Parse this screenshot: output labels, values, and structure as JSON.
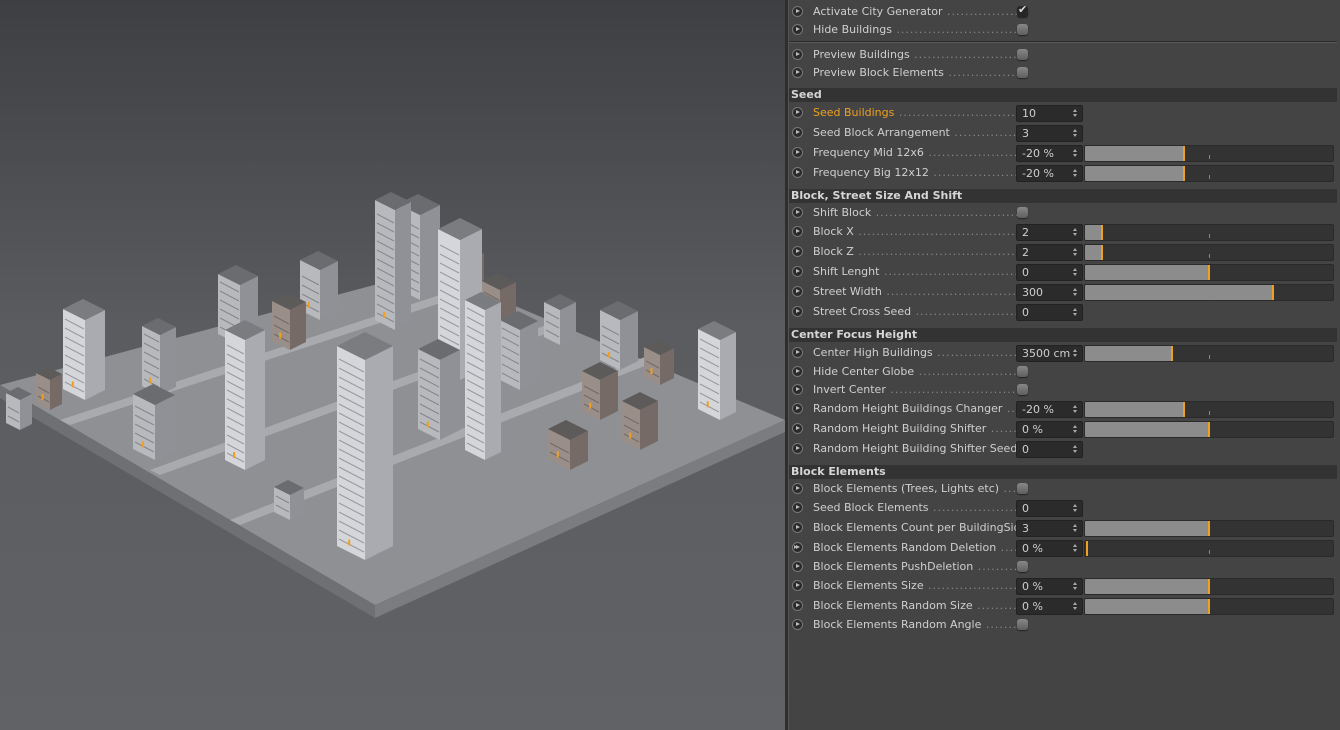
{
  "viewport": {
    "description": "3D render of procedural city block",
    "accent": "#f0a020"
  },
  "panel": {
    "top_rows": [
      {
        "label": "Activate City Generator",
        "type": "checkbox",
        "checked": true
      },
      {
        "label": "Hide Buildings",
        "type": "checkbox",
        "checked": false
      },
      {
        "label": "Preview Buildings",
        "type": "checkbox",
        "checked": false
      },
      {
        "label": "Preview Block Elements",
        "type": "checkbox",
        "checked": false
      }
    ],
    "groups": [
      {
        "title": "Seed",
        "rows": [
          {
            "label": "Seed Buildings",
            "type": "number",
            "value": "10",
            "highlight": true
          },
          {
            "label": "Seed Block Arrangement",
            "type": "number",
            "value": "3"
          },
          {
            "label": "Frequency Mid 12x6",
            "type": "slider",
            "value": "-20 %",
            "fraction": 0.4
          },
          {
            "label": "Frequency Big 12x12",
            "type": "slider",
            "value": "-20 %",
            "fraction": 0.4
          }
        ]
      },
      {
        "title": "Block, Street Size And Shift",
        "rows": [
          {
            "label": "Shift Block",
            "type": "checkbox",
            "checked": false
          },
          {
            "label": "Block X",
            "type": "slider",
            "value": "2",
            "fraction": 0.07
          },
          {
            "label": "Block Z",
            "type": "slider",
            "value": "2",
            "fraction": 0.07
          },
          {
            "label": "Shift Lenght",
            "type": "slider",
            "value": "0",
            "fraction": 0.5
          },
          {
            "label": "Street Width",
            "type": "slider",
            "value": "300",
            "fraction": 0.76
          },
          {
            "label": "Street Cross Seed",
            "type": "number",
            "value": "0"
          }
        ]
      },
      {
        "title": "Center Focus Height",
        "rows": [
          {
            "label": "Center High Buildings",
            "type": "slider",
            "value": "3500 cm",
            "fraction": 0.35
          },
          {
            "label": "Hide Center Globe",
            "type": "checkbox",
            "checked": false
          },
          {
            "label": "Invert Center",
            "type": "checkbox",
            "checked": false
          },
          {
            "label": "Random Height Buildings Changer",
            "type": "slider",
            "value": "-20 %",
            "fraction": 0.4
          },
          {
            "label": "Random Height Building Shifter",
            "type": "slider",
            "value": "0 %",
            "fraction": 0.5
          },
          {
            "label": "Random Height Building Shifter Seed",
            "type": "number",
            "value": "0"
          }
        ]
      },
      {
        "title": "Block Elements",
        "rows": [
          {
            "label": "Block Elements (Trees, Lights etc)",
            "type": "checkbox",
            "checked": false
          },
          {
            "label": "Seed Block Elements",
            "type": "number",
            "value": "0"
          },
          {
            "label": "Block Elements Count per BuildingSide",
            "type": "slider",
            "value": "3",
            "fraction": 0.5
          },
          {
            "label": "Block Elements Random Deletion",
            "type": "slider",
            "value": "0 %",
            "fraction": 0.0,
            "keyframe": "double"
          },
          {
            "label": "Block Elements PushDeletion",
            "type": "checkbox",
            "checked": false
          },
          {
            "label": "Block Elements Size",
            "type": "slider",
            "value": "0 %",
            "fraction": 0.5
          },
          {
            "label": "Block Elements Random Size",
            "type": "slider",
            "value": "0 %",
            "fraction": 0.5
          },
          {
            "label": "Block Elements Random Angle",
            "type": "checkbox",
            "checked": false
          }
        ]
      }
    ]
  }
}
